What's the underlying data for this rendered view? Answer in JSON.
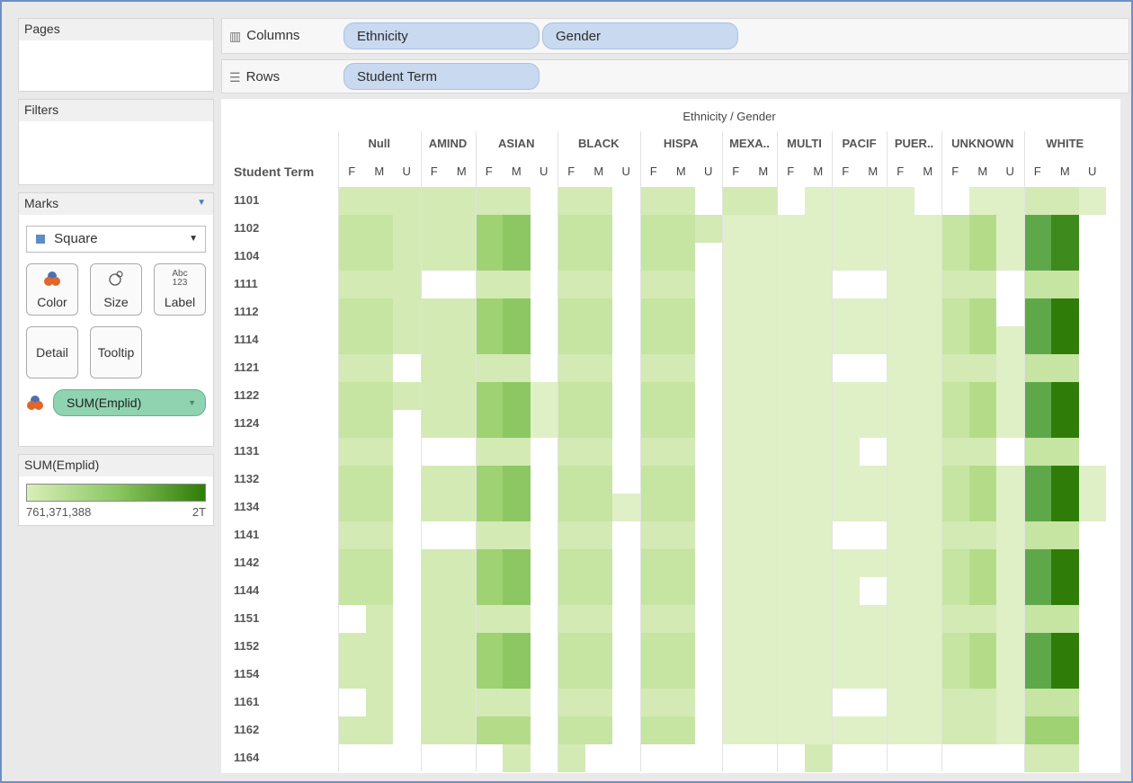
{
  "pages": {
    "title": "Pages"
  },
  "filters": {
    "title": "Filters"
  },
  "marks": {
    "title": "Marks",
    "mark_type": "Square",
    "buttons": [
      "Color",
      "Size",
      "Label",
      "Detail",
      "Tooltip"
    ],
    "label_icon_text": "Abc\n123",
    "color_field": "SUM(Emplid)"
  },
  "legend": {
    "title": "SUM(Emplid)",
    "min_label": "761,371,388",
    "max_label": "2T",
    "colors": {
      "low": "#d9eeb9",
      "high": "#2e7d06"
    }
  },
  "shelves": {
    "columns_label": "Columns",
    "columns_pills": [
      "Ethnicity",
      "Gender"
    ],
    "rows_label": "Rows",
    "rows_pills": [
      "Student Term"
    ]
  },
  "chart_data": {
    "type": "heatmap",
    "title": "Ethnicity / Gender",
    "row_header": "Student Term",
    "rows": [
      "1101",
      "1102",
      "1104",
      "1111",
      "1112",
      "1114",
      "1121",
      "1122",
      "1124",
      "1131",
      "1132",
      "1134",
      "1141",
      "1142",
      "1144",
      "1151",
      "1152",
      "1154",
      "1161",
      "1162",
      "1164"
    ],
    "groups": [
      {
        "name": "Null",
        "genders": [
          "F",
          "M",
          "U"
        ]
      },
      {
        "name": "AMIND",
        "genders": [
          "F",
          "M"
        ]
      },
      {
        "name": "ASIAN",
        "genders": [
          "F",
          "M",
          "U"
        ]
      },
      {
        "name": "BLACK",
        "genders": [
          "F",
          "M",
          "U"
        ]
      },
      {
        "name": "HISPA",
        "genders": [
          "F",
          "M",
          "U"
        ]
      },
      {
        "name": "MEXA..",
        "genders": [
          "F",
          "M"
        ]
      },
      {
        "name": "MULTI",
        "genders": [
          "F",
          "M"
        ]
      },
      {
        "name": "PACIF",
        "genders": [
          "F",
          "M"
        ]
      },
      {
        "name": "PUER..",
        "genders": [
          "F",
          "M"
        ]
      },
      {
        "name": "UNKNOWN",
        "genders": [
          "F",
          "M",
          "U"
        ]
      },
      {
        "name": "WHITE",
        "genders": [
          "F",
          "M",
          "U"
        ]
      }
    ],
    "color_levels": [
      "#ffffff",
      "#dff0c6",
      "#d3eab4",
      "#c6e4a2",
      "#b4dc88",
      "#9fd272",
      "#8cc763",
      "#5fa84a",
      "#3e8a1c",
      "#2f7d08"
    ],
    "values": [
      [
        2,
        2,
        2,
        2,
        2,
        2,
        2,
        0,
        2,
        2,
        0,
        2,
        2,
        0,
        2,
        2,
        0,
        1,
        1,
        1,
        1,
        0,
        0,
        1,
        1,
        2,
        2,
        1,
        3,
        3,
        0
      ],
      [
        3,
        3,
        2,
        2,
        2,
        5,
        6,
        0,
        3,
        3,
        0,
        3,
        3,
        2,
        1,
        1,
        1,
        1,
        1,
        1,
        1,
        1,
        3,
        4,
        1,
        7,
        8,
        0
      ],
      [
        3,
        3,
        2,
        2,
        2,
        5,
        6,
        0,
        3,
        3,
        0,
        3,
        3,
        0,
        1,
        1,
        1,
        1,
        1,
        1,
        1,
        1,
        3,
        4,
        1,
        7,
        8,
        0
      ],
      [
        2,
        2,
        2,
        0,
        0,
        2,
        2,
        0,
        2,
        2,
        0,
        2,
        2,
        0,
        1,
        1,
        1,
        1,
        0,
        0,
        1,
        1,
        2,
        2,
        0,
        3,
        3,
        0
      ],
      [
        3,
        3,
        2,
        2,
        2,
        5,
        6,
        0,
        3,
        3,
        0,
        3,
        3,
        0,
        1,
        1,
        1,
        1,
        1,
        1,
        1,
        1,
        3,
        4,
        0,
        7,
        9,
        0
      ],
      [
        3,
        3,
        2,
        2,
        2,
        5,
        6,
        0,
        3,
        3,
        0,
        3,
        3,
        0,
        1,
        1,
        1,
        1,
        1,
        1,
        1,
        1,
        3,
        4,
        1,
        7,
        9,
        0
      ],
      [
        2,
        2,
        0,
        2,
        2,
        2,
        2,
        0,
        2,
        2,
        0,
        2,
        2,
        0,
        1,
        1,
        1,
        1,
        0,
        0,
        1,
        1,
        2,
        2,
        1,
        3,
        3,
        0
      ],
      [
        3,
        3,
        2,
        2,
        2,
        5,
        6,
        1,
        3,
        3,
        0,
        3,
        3,
        0,
        1,
        1,
        1,
        1,
        1,
        1,
        1,
        1,
        3,
        4,
        1,
        7,
        9,
        0
      ],
      [
        3,
        3,
        0,
        2,
        2,
        5,
        6,
        1,
        3,
        3,
        0,
        3,
        3,
        0,
        1,
        1,
        1,
        1,
        1,
        1,
        1,
        1,
        3,
        4,
        1,
        7,
        9,
        0
      ],
      [
        2,
        2,
        0,
        0,
        0,
        2,
        2,
        0,
        2,
        2,
        0,
        2,
        2,
        0,
        1,
        1,
        1,
        1,
        1,
        0,
        1,
        1,
        2,
        2,
        0,
        3,
        3,
        0
      ],
      [
        3,
        3,
        0,
        2,
        2,
        5,
        6,
        0,
        3,
        3,
        0,
        3,
        3,
        0,
        1,
        1,
        1,
        1,
        1,
        1,
        1,
        1,
        3,
        4,
        1,
        7,
        9,
        1
      ],
      [
        3,
        3,
        0,
        2,
        2,
        5,
        6,
        0,
        3,
        3,
        1,
        3,
        3,
        0,
        1,
        1,
        1,
        1,
        1,
        1,
        1,
        1,
        3,
        4,
        1,
        7,
        9,
        1
      ],
      [
        2,
        2,
        0,
        0,
        0,
        2,
        2,
        0,
        2,
        2,
        0,
        2,
        2,
        0,
        1,
        1,
        1,
        1,
        0,
        0,
        1,
        1,
        2,
        2,
        1,
        3,
        3,
        0
      ],
      [
        3,
        3,
        0,
        2,
        2,
        5,
        6,
        0,
        3,
        3,
        0,
        3,
        3,
        0,
        1,
        1,
        1,
        1,
        1,
        1,
        1,
        1,
        3,
        4,
        1,
        7,
        9,
        0
      ],
      [
        3,
        3,
        0,
        2,
        2,
        5,
        6,
        0,
        3,
        3,
        0,
        3,
        3,
        0,
        1,
        1,
        1,
        1,
        1,
        0,
        1,
        1,
        3,
        4,
        1,
        7,
        9,
        0
      ],
      [
        0,
        2,
        0,
        2,
        2,
        2,
        2,
        0,
        2,
        2,
        0,
        2,
        2,
        0,
        1,
        1,
        1,
        1,
        1,
        1,
        1,
        1,
        2,
        2,
        1,
        3,
        3,
        0
      ],
      [
        2,
        2,
        0,
        2,
        2,
        5,
        6,
        0,
        3,
        3,
        0,
        3,
        3,
        0,
        1,
        1,
        1,
        1,
        1,
        1,
        1,
        1,
        3,
        4,
        1,
        7,
        9,
        0
      ],
      [
        2,
        2,
        0,
        2,
        2,
        5,
        6,
        0,
        3,
        3,
        0,
        3,
        3,
        0,
        1,
        1,
        1,
        1,
        1,
        1,
        1,
        1,
        3,
        4,
        1,
        7,
        9,
        0
      ],
      [
        0,
        2,
        0,
        2,
        2,
        2,
        2,
        0,
        2,
        2,
        0,
        2,
        2,
        0,
        1,
        1,
        1,
        1,
        0,
        0,
        1,
        1,
        2,
        2,
        1,
        3,
        3,
        0
      ],
      [
        2,
        2,
        0,
        2,
        2,
        4,
        4,
        0,
        3,
        3,
        0,
        3,
        3,
        0,
        1,
        1,
        1,
        1,
        1,
        1,
        1,
        1,
        2,
        2,
        1,
        5,
        5,
        0
      ],
      [
        0,
        0,
        0,
        0,
        0,
        0,
        2,
        0,
        2,
        0,
        0,
        0,
        0,
        0,
        0,
        0,
        0,
        2,
        0,
        0,
        0,
        0,
        0,
        0,
        0,
        2,
        2,
        0
      ]
    ]
  }
}
